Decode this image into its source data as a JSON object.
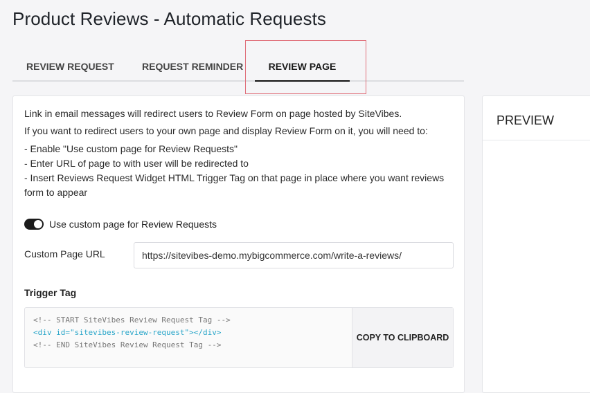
{
  "page": {
    "title": "Product Reviews - Automatic Requests"
  },
  "tabs": [
    {
      "label": "REVIEW REQUEST"
    },
    {
      "label": "REQUEST REMINDER"
    },
    {
      "label": "REVIEW PAGE"
    }
  ],
  "active_tab": "REVIEW PAGE",
  "info": {
    "line1": "Link in email messages will redirect users to Review Form on page hosted by SiteVibes.",
    "line2": "If you want to redirect users to your own page and display Review Form on it, you will need to:",
    "step1": "- Enable \"Use custom page for Review Requests\"",
    "step2": "- Enter URL of page to with user will be redirected to",
    "step3a": "- Insert Reviews Request Widget HTML Trigger Tag on that page in place where you want reviews",
    "step3b": "form to appear"
  },
  "custom_page_toggle": {
    "label": "Use custom page for Review Requests",
    "enabled": true
  },
  "custom_url": {
    "label": "Custom Page URL",
    "value": "https://sitevibes-demo.mybigcommerce.com/write-a-reviews/"
  },
  "trigger_tag": {
    "label": "Trigger Tag",
    "line1": "<!-- START SiteVibes Review Request Tag -->",
    "line2": "<div id=\"sitevibes-review-request\"></div>",
    "line3": "<!-- END SiteVibes Review Request Tag -->",
    "copy_label": "COPY TO CLIPBOARD"
  },
  "preview": {
    "title": "PREVIEW"
  },
  "colors": {
    "toggle_on": "#1b1b1b",
    "highlight": "#e0707b",
    "code_tag": "#2aa6c9"
  }
}
